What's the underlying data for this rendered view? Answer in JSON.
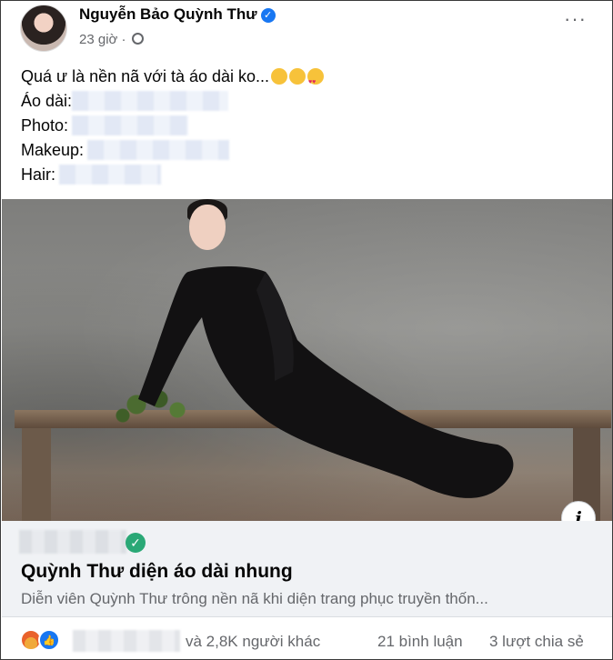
{
  "post": {
    "author": "Nguyễn Bảo Quỳnh Thư",
    "time": "23 giờ",
    "separator": "·",
    "more_label": "···",
    "caption": "Quá ư là nền nã với tà áo dài ko...",
    "credits": [
      {
        "label": "Áo dài:"
      },
      {
        "label": "Photo:"
      },
      {
        "label": "Makeup:"
      },
      {
        "label": "Hair:"
      }
    ]
  },
  "link_card": {
    "info_label": "i",
    "verified_mark": "✓",
    "title": "Quỳnh Thư diện áo dài nhung",
    "description": "Diễn viên Quỳnh Thư trông nền nã khi diện trang phục truyền thốn..."
  },
  "footer": {
    "like_glyph": "👍",
    "others": "và 2,8K người khác",
    "comments": "21 bình luận",
    "shares": "3 lượt chia sẻ"
  },
  "icons": [
    "verified-badge-icon",
    "globe-icon",
    "more-options-icon",
    "laughing-emoji-icon",
    "smiling-emoji-icon",
    "heart-eyes-emoji-icon",
    "info-icon",
    "verified-source-icon",
    "angry-reaction-icon",
    "like-reaction-icon"
  ],
  "colors": {
    "accent": "#1877f2",
    "secondary_text": "#65676b",
    "card_bg": "#f0f2f5",
    "check": "#2aa876"
  }
}
